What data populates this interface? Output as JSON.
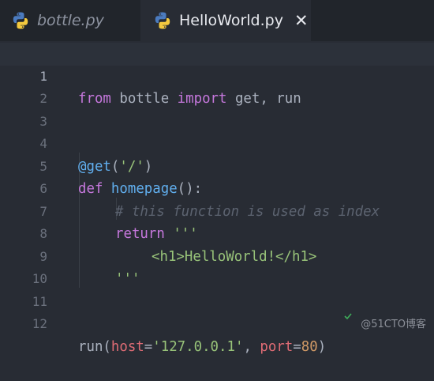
{
  "tabs": [
    {
      "label": "bottle.py",
      "active": false
    },
    {
      "label": "HelloWorld.py",
      "active": true
    }
  ],
  "close_glyph": "✕",
  "icon": "python-icon",
  "colors": {
    "keyword": "#c678dd",
    "function": "#61afef",
    "string": "#98c379",
    "number": "#d19a66",
    "comment": "#5c6370",
    "parameter": "#e06c75",
    "text": "#abb2bf",
    "background": "#282c34"
  },
  "editor": {
    "line_numbers": [
      "1",
      "2",
      "3",
      "4",
      "5",
      "6",
      "7",
      "8",
      "9",
      "10",
      "11",
      "12"
    ],
    "code": {
      "l1": {
        "kw1": "from",
        "t1": " bottle ",
        "kw2": "import",
        "t2": " get, run"
      },
      "l4": {
        "dec": "@get",
        "t1": "(",
        "s1": "'/'",
        "t2": ")"
      },
      "l5": {
        "kw": "def",
        "t1": " ",
        "fn": "homepage",
        "t2": "():"
      },
      "l6": {
        "comment": "# this function is used as index"
      },
      "l7": {
        "kw": "return",
        "t1": " ",
        "s1": "'''"
      },
      "l8": {
        "s1": "<h1>HelloWorld!</h1>"
      },
      "l9": {
        "s1": "'''"
      },
      "l12": {
        "t1": "run(",
        "p1": "host",
        "t2": "=",
        "s1": "'127.0.0.1'",
        "t3": ", ",
        "p2": "port",
        "t4": "=",
        "n1": "80",
        "t5": ")"
      }
    }
  },
  "watermark": "@51CTO博客"
}
